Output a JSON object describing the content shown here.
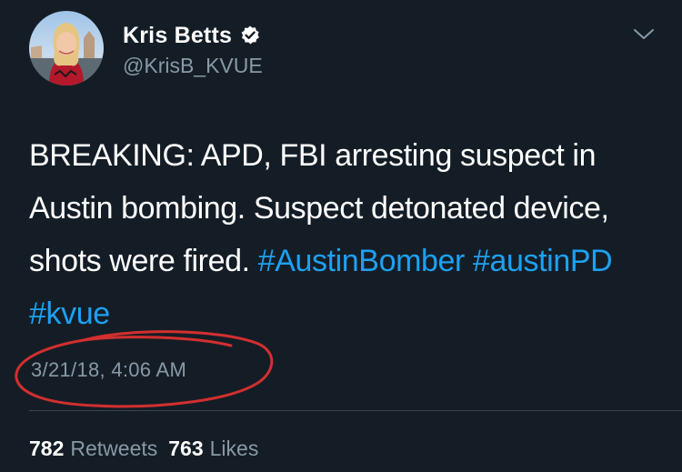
{
  "author": {
    "display_name": "Kris Betts",
    "handle": "@KrisB_KVUE",
    "verified": true
  },
  "tweet": {
    "text_plain": "BREAKING: APD, FBI arresting suspect in Austin bombing. Suspect detonated device, shots were fired.",
    "hashtags": [
      "#AustinBomber",
      "#austinPD",
      "#kvue"
    ],
    "timestamp": "3/21/18, 4:06 AM"
  },
  "stats": {
    "retweets_count": "782",
    "retweets_label": "Retweets",
    "likes_count": "763",
    "likes_label": "Likes"
  },
  "colors": {
    "background": "#141d26",
    "text_primary": "#ffffff",
    "text_secondary": "#8899a6",
    "link": "#1da1f2",
    "verified_badge": "#ffffff",
    "annotation_circle": "#d32f2f"
  },
  "icons": {
    "verified": "verified-badge-icon",
    "menu": "chevron-down-icon"
  }
}
